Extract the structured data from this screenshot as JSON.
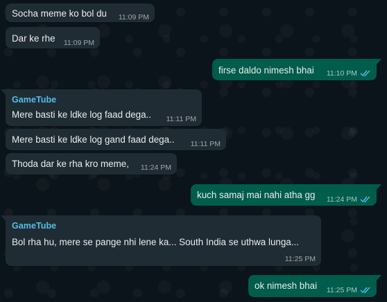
{
  "messages": [
    {
      "text": "Socha meme ko bol du",
      "time": "11:09 PM"
    },
    {
      "text": "Dar ke rhe",
      "time": "11:09 PM"
    },
    {
      "text": "firse daldo nimesh bhai",
      "time": "11:10 PM"
    },
    {
      "sender": "GameTube",
      "text": "Mere basti ke ldke log faad dega..",
      "time": "11:11 PM"
    },
    {
      "text": "Mere basti ke ldke log gand faad dega..",
      "time": "11:11 PM"
    },
    {
      "text": "Thoda dar ke rha kro meme,",
      "time": "11:24 PM"
    },
    {
      "text": "kuch samaj mai nahi atha gg",
      "time": "11:24 PM"
    },
    {
      "sender": "GameTube",
      "text": "Bol rha hu, mere se pange nhi lene ka...  South India se uthwa lunga...",
      "time": "11:25 PM"
    },
    {
      "text": "ok nimesh bhai",
      "time": "11:25 PM"
    }
  ],
  "colors": {
    "background": "#0b141a",
    "incoming_bubble": "#202c33",
    "outgoing_bubble": "#005c4b",
    "sender_name": "#53bdeb",
    "read_ticks": "#53bdeb"
  },
  "icons": {
    "read_receipt": "double-check-icon"
  }
}
